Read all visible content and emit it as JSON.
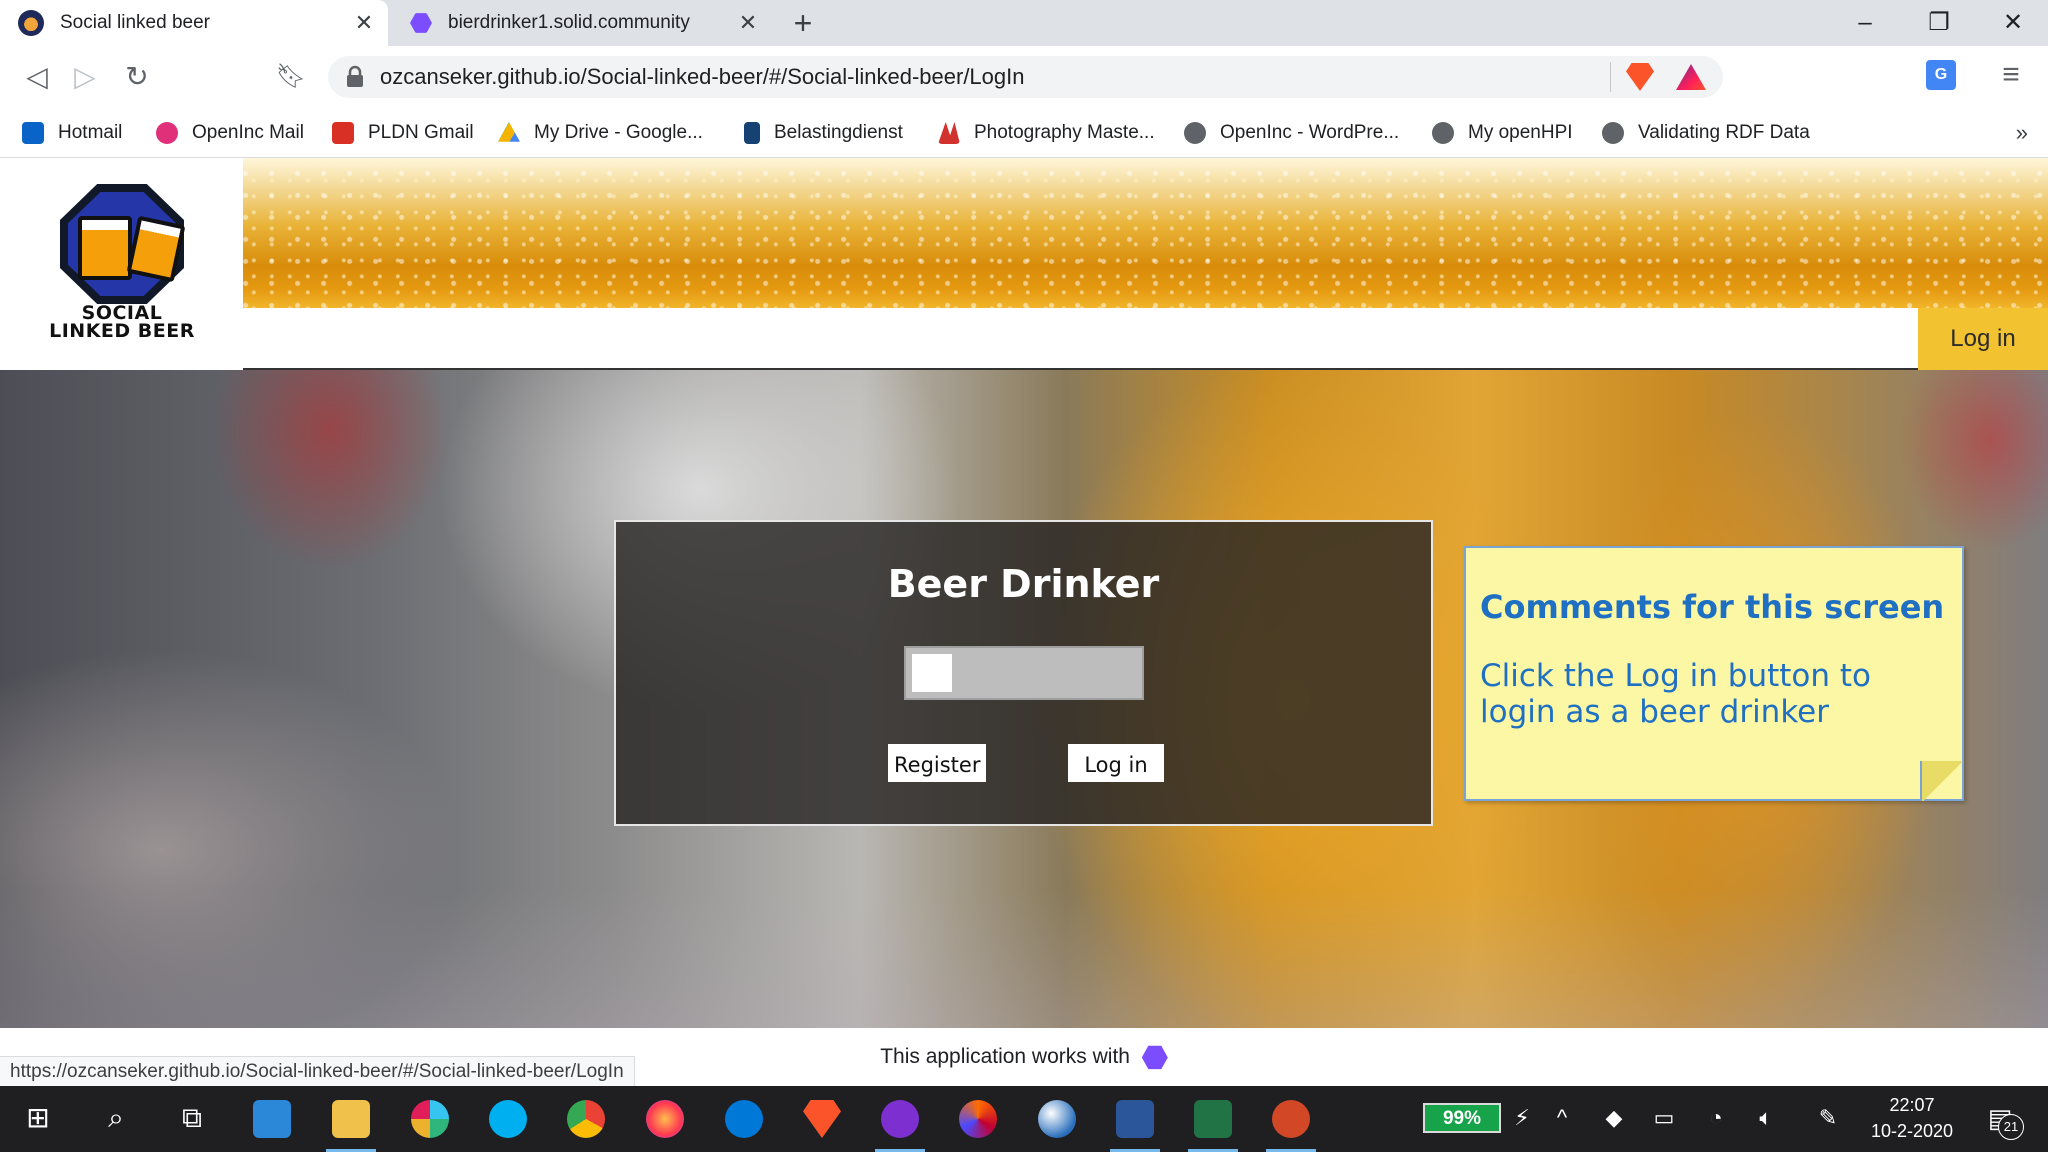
{
  "browser": {
    "tabs": [
      {
        "title": "Social linked beer",
        "active": true
      },
      {
        "title": "bierdrinker1.solid.community",
        "active": false
      }
    ],
    "address": "ozcanseker.github.io/Social-linked-beer/#/Social-linked-beer/LogIn",
    "status_url": "https://ozcanseker.github.io/Social-linked-beer/#/Social-linked-beer/LogIn",
    "bookmarks": [
      {
        "label": "Hotmail",
        "icon": "outlook-icon",
        "color": "#0a64c8"
      },
      {
        "label": "OpenInc Mail",
        "icon": "mail-icon",
        "color": "#e0307a"
      },
      {
        "label": "PLDN Gmail",
        "icon": "gmail-icon",
        "color": "#d93025"
      },
      {
        "label": "My Drive - Google...",
        "icon": "drive-icon",
        "color": "#f4b400"
      },
      {
        "label": "Belastingdienst",
        "icon": "belastingdienst-icon",
        "color": "#154273"
      },
      {
        "label": "Photography Maste...",
        "icon": "photography-icon",
        "color": "#d1322e"
      },
      {
        "label": "OpenInc - WordPre...",
        "icon": "globe-icon",
        "color": "#5f6368"
      },
      {
        "label": "My openHPI",
        "icon": "globe-icon",
        "color": "#5f6368"
      },
      {
        "label": "Validating RDF Data",
        "icon": "globe-icon",
        "color": "#5f6368"
      }
    ],
    "bookmarks_more": "»"
  },
  "site": {
    "logo_text_line1": "SOCIAL",
    "logo_text_line2": "LINKED BEER",
    "nav_login": "Log in",
    "login_title": "Beer Drinker",
    "register_label": "Register",
    "login_label": "Log in",
    "footer_text": "This application works with"
  },
  "note": {
    "title": "Comments for this screen",
    "body": "Click the Log in button to login as a beer drinker"
  },
  "taskbar": {
    "battery": "99%",
    "time": "22:07",
    "date": "10-2-2020",
    "notifications": "21"
  },
  "colors": {
    "accent_yellow": "#f2c230",
    "note_bg": "#fbf7a4",
    "note_text": "#1f6fc3",
    "solid_purple": "#7c4dff"
  }
}
